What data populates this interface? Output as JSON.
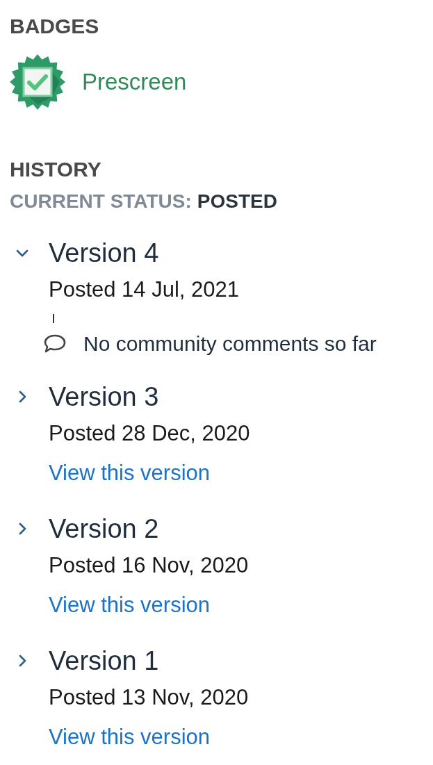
{
  "badges": {
    "heading": "BADGES",
    "items": [
      {
        "label": "Prescreen"
      }
    ]
  },
  "history": {
    "heading": "HISTORY",
    "status_label": "CURRENT STATUS:",
    "status_value": "POSTED",
    "versions": [
      {
        "title": "Version 4",
        "posted": "Posted 14 Jul, 2021",
        "expanded": true,
        "comment": "No community comments so far"
      },
      {
        "title": "Version 3",
        "posted": "Posted 28 Dec, 2020",
        "expanded": false,
        "link": "View this version"
      },
      {
        "title": "Version 2",
        "posted": "Posted 16 Nov, 2020",
        "expanded": false,
        "link": "View this version"
      },
      {
        "title": "Version 1",
        "posted": "Posted 13 Nov, 2020",
        "expanded": false,
        "link": "View this version"
      }
    ]
  }
}
